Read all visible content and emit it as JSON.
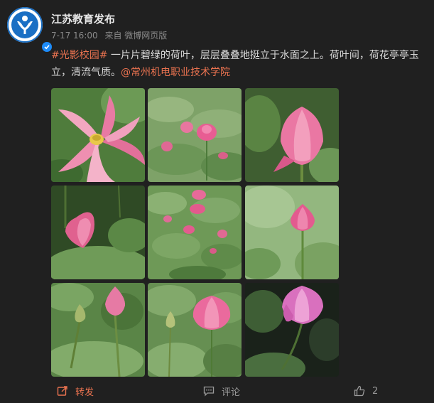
{
  "post": {
    "username": "江苏教育发布",
    "time": "7-17 16:00",
    "source": "来自 微博网页版",
    "hashtag": "#光影校园#",
    "text": " 一片片碧绿的荷叶，层层叠叠地挺立于水面之上。荷叶间，荷花亭亭玉立，清流气质。",
    "mention": "@常州机电职业技术学院"
  },
  "images": [
    {
      "name": "photo-1-lotus-open"
    },
    {
      "name": "photo-2-lotus-pond"
    },
    {
      "name": "photo-3-lotus-bud"
    },
    {
      "name": "photo-4-lotus-bud"
    },
    {
      "name": "photo-5-lotus-field"
    },
    {
      "name": "photo-6-lotus-bud-stem"
    },
    {
      "name": "photo-7-lotus-buds"
    },
    {
      "name": "photo-8-lotus-flower"
    },
    {
      "name": "photo-9-lotus-pink"
    }
  ],
  "actions": {
    "share_label": "转发",
    "comment_label": "评论",
    "like_count": "2"
  },
  "colors": {
    "background": "#202020",
    "accent": "#eb7350",
    "verified": "#1d8bf8"
  },
  "icons": [
    "verified-badge-icon",
    "share-icon",
    "comment-icon",
    "like-icon"
  ]
}
